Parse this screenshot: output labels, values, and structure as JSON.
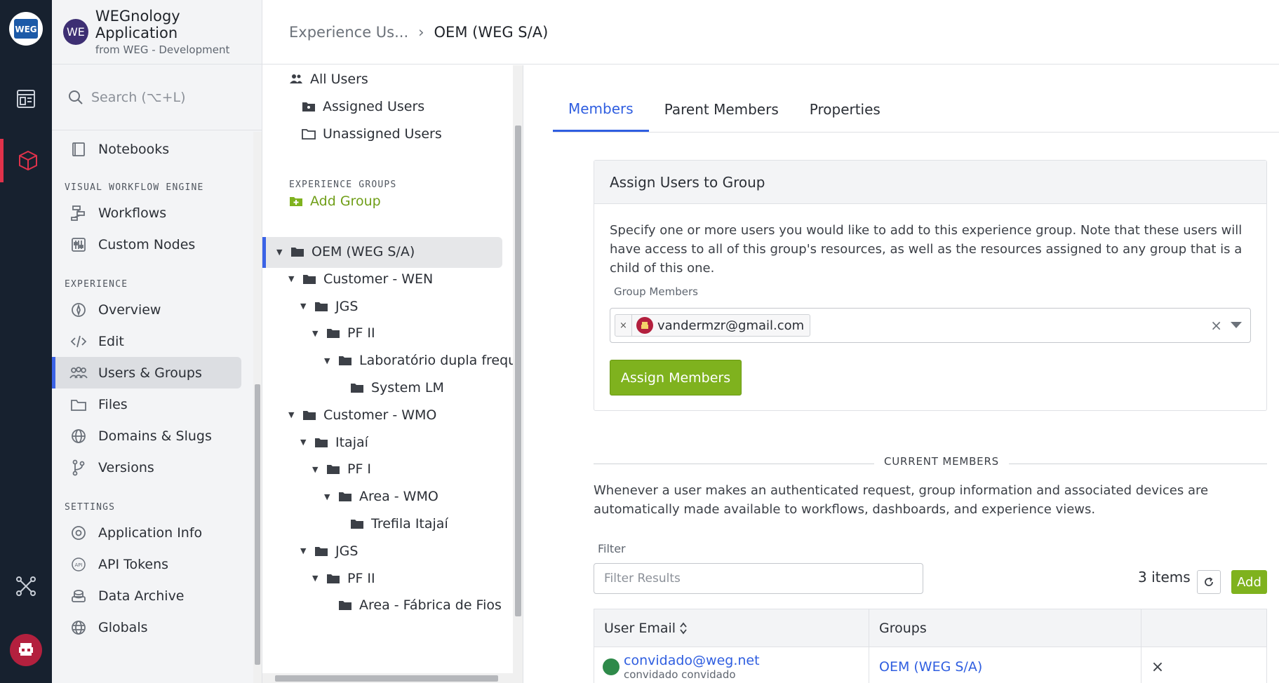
{
  "app": {
    "badge": "WE",
    "title": "WEGnology Application",
    "subtitle": "from WEG - Development"
  },
  "search": {
    "placeholder": "Search (⌥+L)"
  },
  "breadcrumb": {
    "parent": "Experience Us...",
    "separator": "›",
    "current": "OEM (WEG S/A)"
  },
  "sidebar": {
    "top_items": [
      {
        "label": "Notebooks",
        "icon": "book-icon"
      }
    ],
    "sections": [
      {
        "title": "VISUAL WORKFLOW ENGINE",
        "items": [
          {
            "label": "Workflows",
            "icon": "workflow-icon"
          },
          {
            "label": "Custom Nodes",
            "icon": "sliders-icon"
          }
        ]
      },
      {
        "title": "EXPERIENCE",
        "items": [
          {
            "label": "Overview",
            "icon": "compass-icon"
          },
          {
            "label": "Edit",
            "icon": "code-icon"
          },
          {
            "label": "Users & Groups",
            "icon": "users-icon"
          },
          {
            "label": "Files",
            "icon": "folder-icon"
          },
          {
            "label": "Domains & Slugs",
            "icon": "globe-icon"
          },
          {
            "label": "Versions",
            "icon": "branch-icon"
          }
        ]
      },
      {
        "title": "SETTINGS",
        "items": [
          {
            "label": "Application Info",
            "icon": "gear-icon"
          },
          {
            "label": "API Tokens",
            "icon": "api-icon"
          },
          {
            "label": "Data Archive",
            "icon": "archive-icon"
          },
          {
            "label": "Globals",
            "icon": "globe-icon"
          }
        ]
      }
    ]
  },
  "tree": {
    "all_users": "All Users",
    "assigned_users": "Assigned Users",
    "unassigned_users": "Unassigned Users",
    "section": "EXPERIENCE GROUPS",
    "add_group": "Add Group",
    "nodes": [
      {
        "label": "OEM (WEG S/A)",
        "level": 0
      },
      {
        "label": "Customer - WEN",
        "level": 1
      },
      {
        "label": "JGS",
        "level": 2
      },
      {
        "label": "PF II",
        "level": 3
      },
      {
        "label": "Laboratório dupla frequ",
        "level": 4
      },
      {
        "label": "System LM",
        "level": 5
      },
      {
        "label": "Customer - WMO",
        "level": 1
      },
      {
        "label": "Itajaí",
        "level": 2
      },
      {
        "label": "PF I",
        "level": 3
      },
      {
        "label": "Area - WMO",
        "level": 4
      },
      {
        "label": "Trefila Itajaí",
        "level": 5
      },
      {
        "label": "JGS",
        "level": 2
      },
      {
        "label": "PF II",
        "level": 3
      },
      {
        "label": "Area - Fábrica de Fios",
        "level": 4
      }
    ]
  },
  "tabs": [
    "Members",
    "Parent Members",
    "Properties"
  ],
  "assign": {
    "title": "Assign Users to Group",
    "description": "Specify one or more users you would like to add to this experience group. Note that these users will have access to all of this group's resources, as well as the resources assigned to any group that is a child of this one.",
    "field_label": "Group Members",
    "chip_remove": "×",
    "chip_email": "vandermzr@gmail.com",
    "clear": "×",
    "button": "Assign Members"
  },
  "current_members": {
    "title": "CURRENT MEMBERS",
    "description": "Whenever a user makes an authenticated request, group information and associated devices are automatically made available to workflows, dashboards, and experience views.",
    "filter_label": "Filter",
    "filter_placeholder": "Filter Results",
    "count": "3 items",
    "add": "Add",
    "columns": {
      "email": "User Email",
      "groups": "Groups"
    },
    "rows": [
      {
        "email": "convidado@weg.net",
        "name": "convidado convidado",
        "group": "OEM (WEG S/A)",
        "remove": "×"
      }
    ]
  },
  "colors": {
    "accent": "#2f5ee0",
    "green": "#7fb21e",
    "rail": "#17212f",
    "rail_active": "#e0324b"
  }
}
